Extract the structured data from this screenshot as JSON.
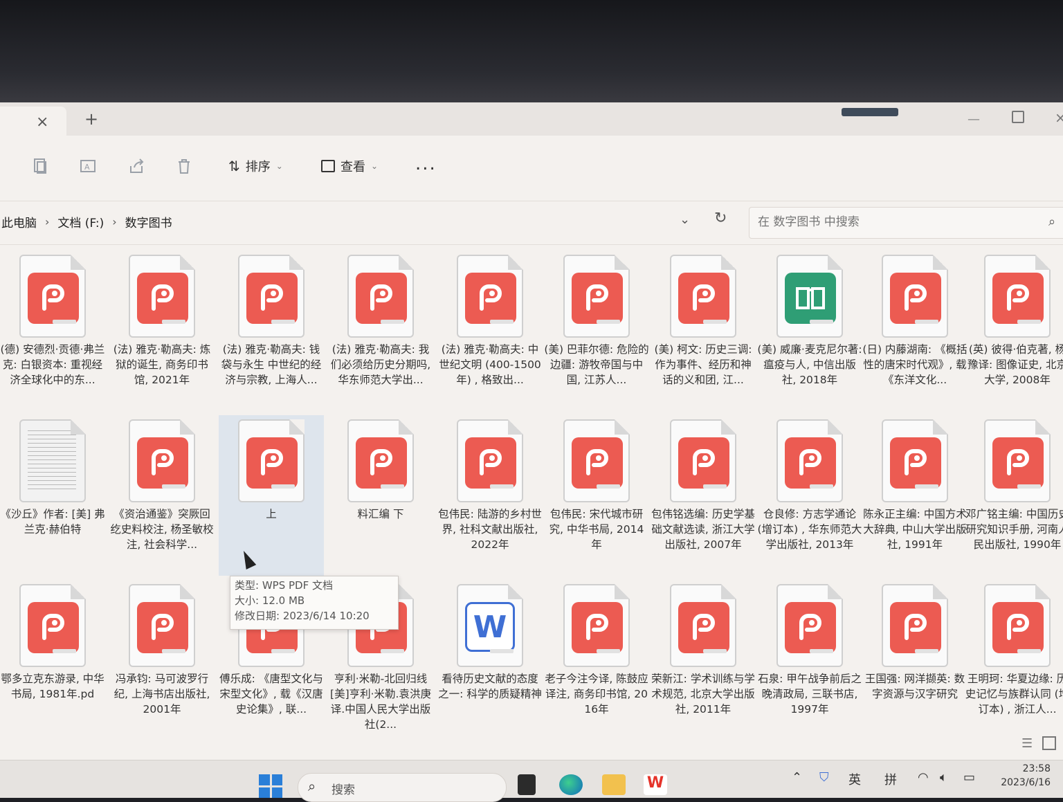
{
  "tabs": {
    "close_glyph": "×",
    "new_tab_glyph": "+"
  },
  "toolbar": {
    "sort_label": "排序",
    "view_label": "查看",
    "more_glyph": "..."
  },
  "breadcrumb": [
    "此电脑",
    "文档 (F:)",
    "数字图书"
  ],
  "search": {
    "placeholder": "在 数字图书 中搜索"
  },
  "colors": {
    "pdf": "#ec5b52",
    "book": "#2f9e75",
    "word": "#3f6fd4",
    "selection": "#b4cdeb"
  },
  "files_row1": [
    {
      "name": "(德) 安德烈·贡德·弗兰克: 白银资本: 重视经济全球化中的东...",
      "icon": "pdf-icon"
    },
    {
      "name": "(法) 雅克·勒高夫: 炼狱的诞生, 商务印书馆, 2021年",
      "icon": "pdf-icon"
    },
    {
      "name": "(法) 雅克·勒高夫: 钱袋与永生 中世纪的经济与宗教, 上海人...",
      "icon": "pdf-icon"
    },
    {
      "name": "(法) 雅克·勒高夫: 我们必须给历史分期吗, 华东师范大学出...",
      "icon": "pdf-icon"
    },
    {
      "name": "(法) 雅克·勒高夫: 中世纪文明 (400-1500年) , 格致出...",
      "icon": "pdf-icon"
    },
    {
      "name": "(美) 巴菲尔德: 危险的边疆: 游牧帝国与中国, 江苏人...",
      "icon": "pdf-icon"
    },
    {
      "name": "(美) 柯文: 历史三调: 作为事件、经历和神话的义和团, 江...",
      "icon": "pdf-icon"
    },
    {
      "name": "(美) 威廉·麦克尼尔著: 瘟疫与人, 中信出版社, 2018年",
      "icon": "book-icon"
    },
    {
      "name": "(日) 内藤湖南: 《概括性的唐宋时代观》, 载《东洋文化...",
      "icon": "pdf-icon"
    },
    {
      "name": "(英) 彼得·伯克著, 杨豫译: 图像证史, 北京大学, 2008年",
      "icon": "pdf-icon"
    }
  ],
  "files_row2": [
    {
      "name": "《沙丘》作者: [美] 弗兰克·赫伯特",
      "icon": "text-file-icon"
    },
    {
      "name": "《资治通鉴》突厥回纥史料校注, 杨圣敏校注, 社会科学...",
      "icon": "pdf-icon"
    },
    {
      "name": "上",
      "icon": "pdf-icon"
    },
    {
      "name": "料汇编 下",
      "icon": "pdf-icon"
    },
    {
      "name": "包伟民: 陆游的乡村世界, 社科文献出版社, 2022年",
      "icon": "pdf-icon"
    },
    {
      "name": "包伟民: 宋代城市研究, 中华书局, 2014年",
      "icon": "pdf-icon"
    },
    {
      "name": "包伟铭选编: 历史学基础文献选读, 浙江大学出版社, 2007年",
      "icon": "pdf-icon"
    },
    {
      "name": "仓良修: 方志学通论 (增订本) , 华东师范大学出版社, 2013年",
      "icon": "pdf-icon"
    },
    {
      "name": "陈永正主编: 中国方术大辞典, 中山大学出版社, 1991年",
      "icon": "pdf-icon"
    },
    {
      "name": "邓广铭主编: 中国历史研究知识手册, 河南人民出版社, 1990年",
      "icon": "pdf-icon"
    }
  ],
  "files_row3": [
    {
      "name": "鄂多立克东游录, 中华书局, 1981年.pd",
      "icon": "pdf-icon"
    },
    {
      "name": "冯承钧: 马可波罗行纪, 上海书店出版社, 2001年",
      "icon": "pdf-icon"
    },
    {
      "name": "傅乐成: 《唐型文化与宋型文化》, 载《汉唐史论集》, 联...",
      "icon": "pdf-icon"
    },
    {
      "name": "亨利·米勒-北回归线[美]亨利·米勒.袁洪庚译.中国人民大学出版社(2...",
      "icon": "pdf-icon"
    },
    {
      "name": "看待历史文献的态度之一: 科学的质疑精神",
      "icon": "word-icon"
    },
    {
      "name": "老子今注今译, 陈鼓应译注, 商务印书馆, 2016年",
      "icon": "pdf-icon"
    },
    {
      "name": "荣新江: 学术训练与学术规范, 北京大学出版社, 2011年",
      "icon": "pdf-icon"
    },
    {
      "name": "石泉: 甲午战争前后之晚清政局, 三联书店, 1997年",
      "icon": "pdf-icon"
    },
    {
      "name": "王国强: 网洋撷英: 数字资源与汉字研究",
      "icon": "pdf-icon"
    },
    {
      "name": "王明珂: 华夏边缘: 历史记忆与族群认同 (增订本) , 浙江人...",
      "icon": "pdf-icon"
    }
  ],
  "tooltip": {
    "type": "类型: WPS PDF 文档",
    "size": "大小: 12.0 MB",
    "modified": "修改日期: 2023/6/14 10:20"
  },
  "taskbar": {
    "search_label": "搜索",
    "ime_lang": "英",
    "ime_mode": "拼",
    "time": "23:58",
    "date": "2023/6/16"
  }
}
